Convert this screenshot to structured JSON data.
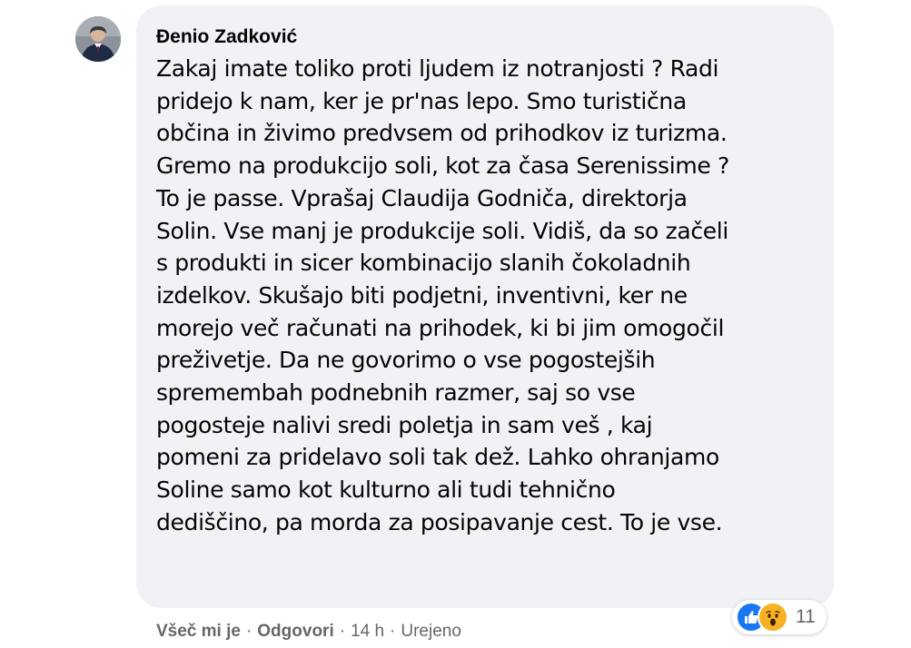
{
  "comment": {
    "author": "Đenio Zadković",
    "lines": [
      "Zakaj imate toliko proti ljudem iz notranjosti ? Radi",
      "pridejo k nam, ker je pr'nas lepo. Smo turistična",
      "občina in živimo predvsem od prihodkov iz turizma.",
      "Gremo na produkcijo soli, kot za časa Serenissime ?",
      "To je passe. Vprašaj Claudija Godniča, direktorja",
      "Solin. Vse manj je produkcije soli. Vidiš, da so začeli",
      "s produkti in sicer kombinacijo slanih čokoladnih",
      "izdelkov. Skušajo biti podjetni, inventivni, ker ne",
      "morejo več računati na prihodek, ki bi jim omogočil",
      "preživetje. Da ne govorimo o vse pogostejših",
      "sprememb​ah podnebnih razmer, saj so vse",
      "pogosteje nalivi sredi poletja in sam veš , kaj",
      "pomeni za pridelavo soli tak dež. Lahko ohranjamo",
      "Soline samo kot kulturno ali tudi tehnično",
      "dediščino, pa morda za posipavanje cest. To je vse."
    ]
  },
  "reactions": {
    "icons": [
      "like-icon",
      "wow-icon"
    ],
    "count": "11"
  },
  "actions": {
    "like": "Všeč mi je",
    "reply": "Odgovori",
    "separator": "·",
    "time": "14 h",
    "edited": "Urejeno"
  },
  "colors": {
    "bubble": "#f0f2f5",
    "text": "#050505",
    "muted": "#65676b",
    "like": "#1877f2",
    "wow": "#f7b125"
  }
}
